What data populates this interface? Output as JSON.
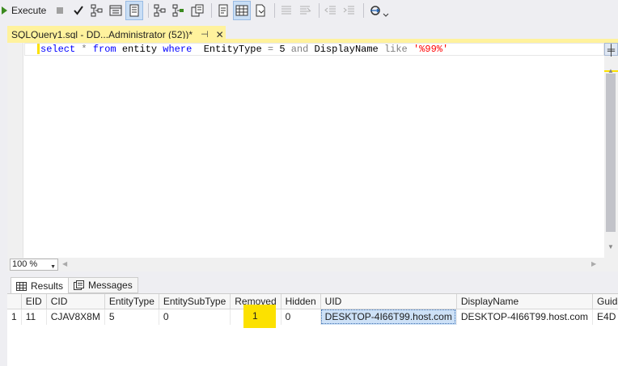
{
  "toolbar": {
    "execute_label": "Execute",
    "icons": [
      "play-icon",
      "stop-icon",
      "parse-checkmark-icon",
      "display-estimated-plan-icon",
      "query-designer-icon",
      "results-to-text-icon",
      "include-actual-plan-icon",
      "include-client-stats-icon",
      "results-to-grid-icon",
      "results-to-file-icon",
      "comment-icon",
      "uncomment-icon",
      "decrease-indent-icon",
      "increase-indent-icon",
      "specify-values-icon"
    ]
  },
  "document_tab": {
    "title": "SQLQuery1.sql - DD...Administrator (52))*",
    "pin_glyph": "⊣",
    "close_glyph": "✕"
  },
  "editor": {
    "tokens": {
      "select": "select",
      "star": "*",
      "from": "from",
      "table": "entity",
      "where": "where",
      "col1": "EntityType",
      "eq": "=",
      "num": "5",
      "and": "and",
      "col2": "DisplayName",
      "like": "like",
      "pattern": "'%99%'"
    }
  },
  "zoom": {
    "value": "100 %"
  },
  "results": {
    "tabs": [
      {
        "label": "Results",
        "icon": "grid-icon",
        "selected": true
      },
      {
        "label": "Messages",
        "icon": "messages-icon",
        "selected": false
      }
    ],
    "columns": [
      "EID",
      "CID",
      "EntityType",
      "EntitySubType",
      "Removed",
      "Hidden",
      "UID",
      "DisplayName",
      "Guid"
    ],
    "rows": [
      {
        "row_number": "1",
        "cells": [
          "11",
          "CJAV8X8M",
          "5",
          "0",
          "1",
          "0",
          "DESKTOP-4I66T99.host.com",
          "DESKTOP-4I66T99.host.com",
          "E4D"
        ]
      }
    ],
    "selected_column": "UID",
    "highlight_color": "#fce100"
  },
  "colors": {
    "tab_accent": "#fff29d",
    "keyword": "#0000ff",
    "string": "#ff0000",
    "operator": "#808080"
  }
}
